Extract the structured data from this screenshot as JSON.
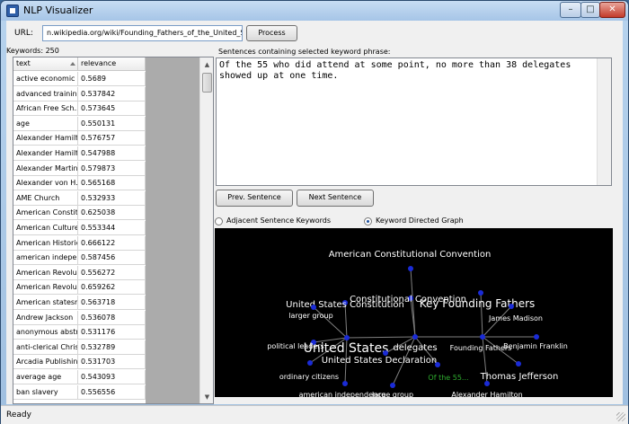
{
  "window": {
    "title": "NLP Visualizer"
  },
  "url": {
    "label": "URL:",
    "value": "n.wikipedia.org/wiki/Founding_Fathers_of_the_United_States"
  },
  "buttons": {
    "process": "Process",
    "prev": "Prev. Sentence",
    "next": "Next Sentence"
  },
  "keywords": {
    "label": "Keywords: 250",
    "columns": [
      "text",
      "relevance"
    ],
    "rows": [
      [
        "active economic ...",
        "0.5689"
      ],
      [
        "advanced training",
        "0.537842"
      ],
      [
        "African Free Sch...",
        "0.573645"
      ],
      [
        "age",
        "0.550131"
      ],
      [
        "Alexander Hamilton",
        "0.576757"
      ],
      [
        "Alexander Hamilt...",
        "0.547988"
      ],
      [
        "Alexander Martin",
        "0.579873"
      ],
      [
        "Alexander von H...",
        "0.565168"
      ],
      [
        "AME Church",
        "0.532933"
      ],
      [
        "American Constit...",
        "0.625038"
      ],
      [
        "American Culture",
        "0.553344"
      ],
      [
        "American Historic...",
        "0.666122"
      ],
      [
        "american indepe...",
        "0.587456"
      ],
      [
        "American Revolu...",
        "0.556272"
      ],
      [
        "American Revolu...",
        "0.659262"
      ],
      [
        "American statesm...",
        "0.563718"
      ],
      [
        "Andrew Jackson",
        "0.536078"
      ],
      [
        "anonymous abstr...",
        "0.531176"
      ],
      [
        "anti-clerical Christ...",
        "0.532789"
      ],
      [
        "Arcadia Publishing",
        "0.531703"
      ],
      [
        "average age",
        "0.543093"
      ],
      [
        "ban slavery",
        "0.556556"
      ]
    ]
  },
  "sentences": {
    "label": "Sentences containing selected keyword phrase:",
    "text": "Of the 55 who did attend at some point, no more than 38 delegates\nshowed up at one time."
  },
  "options": {
    "adjacent": {
      "label": "Adjacent Sentence Keywords",
      "selected": false
    },
    "directed": {
      "label": "Keyword Directed Graph",
      "selected": true
    }
  },
  "graph": {
    "nodes": [
      {
        "id": "acc",
        "label": "American Constitutional Convention",
        "size": "m"
      },
      {
        "id": "usc",
        "label": "United States Constitution",
        "size": "m"
      },
      {
        "id": "cc",
        "label": "Constitutional Convention",
        "size": "m"
      },
      {
        "id": "kff",
        "label": "Key Founding Fathers",
        "size": "l"
      },
      {
        "id": "lg",
        "label": "larger group",
        "size": "s"
      },
      {
        "id": "jm",
        "label": "James Madison",
        "size": "s"
      },
      {
        "id": "pl",
        "label": "political leaders",
        "size": "s"
      },
      {
        "id": "us",
        "label": "United States",
        "size": "xl"
      },
      {
        "id": "del",
        "label": "delegates",
        "size": "m"
      },
      {
        "id": "ff",
        "label": "Founding Fathers",
        "size": "s"
      },
      {
        "id": "bf",
        "label": "Benjamin Franklin",
        "size": "s"
      },
      {
        "id": "usd",
        "label": "United States Declaration",
        "size": "m"
      },
      {
        "id": "oc",
        "label": "ordinary citizens",
        "size": "s"
      },
      {
        "id": "sent",
        "label": "Of the 55...",
        "size": "s",
        "highlight": true
      },
      {
        "id": "tj",
        "label": "Thomas Jefferson",
        "size": "m"
      },
      {
        "id": "ai",
        "label": "american independence",
        "size": "s"
      },
      {
        "id": "lgb",
        "label": "large group",
        "size": "s"
      },
      {
        "id": "ah",
        "label": "Alexander Hamilton",
        "size": "s"
      }
    ],
    "edges": [
      [
        "usc",
        "us"
      ],
      [
        "lg",
        "us"
      ],
      [
        "pl",
        "us"
      ],
      [
        "oc",
        "us"
      ],
      [
        "ai",
        "us"
      ],
      [
        "us",
        "del"
      ],
      [
        "cc",
        "del"
      ],
      [
        "acc",
        "del"
      ],
      [
        "del",
        "usd"
      ],
      [
        "del",
        "ff"
      ],
      [
        "lgb",
        "del"
      ],
      [
        "sent",
        "del"
      ],
      [
        "kff",
        "ff"
      ],
      [
        "jm",
        "ff"
      ],
      [
        "bf",
        "ff"
      ],
      [
        "tj",
        "ff"
      ],
      [
        "ah",
        "ff"
      ]
    ],
    "colors": {
      "background": "#000000",
      "node": "#1a2bd6",
      "label": "#ffffff",
      "highlight": "#2fae2f",
      "edge": "#7f7f7f"
    }
  },
  "status": {
    "text": "Ready"
  }
}
